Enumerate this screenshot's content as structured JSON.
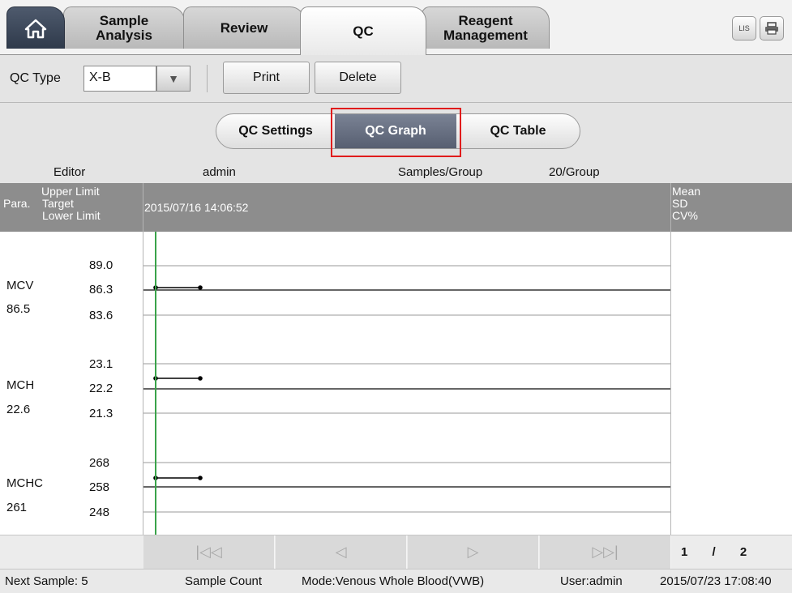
{
  "tabs": {
    "sample_analysis": "Sample\nAnalysis",
    "review": "Review",
    "qc": "QC",
    "reagent_management": "Reagent\nManagement",
    "lis_icon": "LIS"
  },
  "toolbar": {
    "qc_type_label": "QC Type",
    "qc_type_value": "X-B",
    "print_label": "Print",
    "delete_label": "Delete"
  },
  "segments": {
    "settings": "QC Settings",
    "graph": "QC Graph",
    "table": "QC Table",
    "active": "QC Graph"
  },
  "info": {
    "editor_label": "Editor",
    "editor_value": "admin",
    "samples_label": "Samples/Group",
    "samples_value": "20/Group"
  },
  "grid_header": {
    "upper": "Upper Limit",
    "para": "Para.",
    "target": "Target",
    "lower": "Lower Limit",
    "datetime": "2015/07/16 14:06:52",
    "mean": "Mean",
    "sd": "SD",
    "cv": "CV%"
  },
  "params": [
    {
      "name": "MCV",
      "value": "86.5",
      "upper": "89.0",
      "target": "86.3",
      "lower": "83.6"
    },
    {
      "name": "MCH",
      "value": "22.6",
      "upper": "23.1",
      "target": "22.2",
      "lower": "21.3"
    },
    {
      "name": "MCHC",
      "value": "261",
      "upper": "268",
      "target": "258",
      "lower": "248"
    }
  ],
  "pager": {
    "first_icon": "first-page-icon",
    "prev_icon": "prev-page-icon",
    "next_icon": "next-page-icon",
    "last_icon": "last-page-icon",
    "current_page": "1",
    "separator": "/",
    "total_pages": "2"
  },
  "status": {
    "next_sample": "Next Sample: 5",
    "sample_count": "Sample Count",
    "mode": "Mode:Venous Whole Blood(VWB)",
    "user": "User:admin",
    "datetime": "2015/07/23 17:08:40"
  },
  "colors": {
    "active_segment": "#60687a",
    "highlight": "#e01c1c",
    "header_grey": "#8d8d8d",
    "cursor_line": "#3aa34a"
  }
}
